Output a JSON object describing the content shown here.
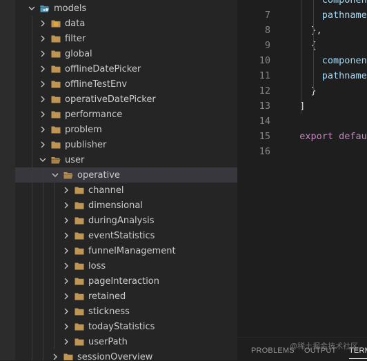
{
  "explorer": {
    "items": [
      {
        "label": "models",
        "depth": 0,
        "expanded": true,
        "icon": "models-folder-open-icon"
      },
      {
        "label": "data",
        "depth": 1,
        "expanded": false,
        "icon": "database-folder-icon"
      },
      {
        "label": "filter",
        "depth": 1,
        "expanded": false,
        "icon": "folder-icon"
      },
      {
        "label": "global",
        "depth": 1,
        "expanded": false,
        "icon": "folder-icon"
      },
      {
        "label": "offlineDatePicker",
        "depth": 1,
        "expanded": false,
        "icon": "folder-icon"
      },
      {
        "label": "offlineTestEnv",
        "depth": 1,
        "expanded": false,
        "icon": "folder-icon"
      },
      {
        "label": "operativeDatePicker",
        "depth": 1,
        "expanded": false,
        "icon": "folder-icon"
      },
      {
        "label": "performance",
        "depth": 1,
        "expanded": false,
        "icon": "folder-icon"
      },
      {
        "label": "problem",
        "depth": 1,
        "expanded": false,
        "icon": "folder-icon"
      },
      {
        "label": "publisher",
        "depth": 1,
        "expanded": false,
        "icon": "folder-icon"
      },
      {
        "label": "user",
        "depth": 1,
        "expanded": true,
        "icon": "folder-open-icon"
      },
      {
        "label": "operative",
        "depth": 2,
        "expanded": true,
        "icon": "folder-open-icon",
        "selected": true
      },
      {
        "label": "channel",
        "depth": 3,
        "expanded": false,
        "icon": "folder-icon"
      },
      {
        "label": "dimensional",
        "depth": 3,
        "expanded": false,
        "icon": "folder-icon"
      },
      {
        "label": "duringAnalysis",
        "depth": 3,
        "expanded": false,
        "icon": "folder-icon"
      },
      {
        "label": "eventStatistics",
        "depth": 3,
        "expanded": false,
        "icon": "folder-icon"
      },
      {
        "label": "funnelManagement",
        "depth": 3,
        "expanded": false,
        "icon": "folder-icon"
      },
      {
        "label": "loss",
        "depth": 3,
        "expanded": false,
        "icon": "folder-icon"
      },
      {
        "label": "pageInteraction",
        "depth": 3,
        "expanded": false,
        "icon": "folder-icon"
      },
      {
        "label": "retained",
        "depth": 3,
        "expanded": false,
        "icon": "folder-icon"
      },
      {
        "label": "stickness",
        "depth": 3,
        "expanded": false,
        "icon": "folder-icon"
      },
      {
        "label": "todayStatistics",
        "depth": 3,
        "expanded": false,
        "icon": "folder-icon"
      },
      {
        "label": "userPath",
        "depth": 3,
        "expanded": false,
        "icon": "folder-icon"
      },
      {
        "label": "sessionOverview",
        "depth": 2,
        "expanded": false,
        "icon": "folder-icon"
      }
    ]
  },
  "editor": {
    "lines": [
      {
        "num": "",
        "tokens": [
          {
            "t": "      component",
            "c": "#9cdcfe"
          }
        ]
      },
      {
        "num": "7",
        "tokens": [
          {
            "t": "      pathname:",
            "c": "#9cdcfe"
          }
        ]
      },
      {
        "num": "8",
        "tokens": [
          {
            "t": "    },",
            "c": "#d4d4d4"
          }
        ]
      },
      {
        "num": "9",
        "tokens": [
          {
            "t": "    {",
            "c": "#d4d4d4"
          }
        ]
      },
      {
        "num": "10",
        "tokens": [
          {
            "t": "      component",
            "c": "#9cdcfe"
          }
        ]
      },
      {
        "num": "11",
        "tokens": [
          {
            "t": "      pathname:",
            "c": "#9cdcfe"
          }
        ]
      },
      {
        "num": "12",
        "tokens": [
          {
            "t": "    }",
            "c": "#d4d4d4"
          }
        ]
      },
      {
        "num": "13",
        "tokens": [
          {
            "t": "  ]",
            "c": "#d4d4d4"
          }
        ]
      },
      {
        "num": "14",
        "tokens": [
          {
            "t": "",
            "c": "#d4d4d4"
          }
        ]
      },
      {
        "num": "15",
        "tokens": [
          {
            "t": "  export ",
            "c": "#c586c0"
          },
          {
            "t": "defaul",
            "c": "#c586c0"
          }
        ]
      },
      {
        "num": "16",
        "tokens": [
          {
            "t": "",
            "c": "#d4d4d4"
          }
        ]
      }
    ]
  },
  "panel": {
    "tabs": [
      {
        "label": "PROBLEMS",
        "active": false
      },
      {
        "label": "OUTPUT",
        "active": false
      },
      {
        "label": "TERM",
        "active": true
      }
    ],
    "watermark": "@稀土掘金技术社区"
  },
  "colors": {
    "folder": "#c09553",
    "chevron": "#c5c5c5",
    "models_icon": "#519aba",
    "data_icon": "#e2a53a"
  }
}
